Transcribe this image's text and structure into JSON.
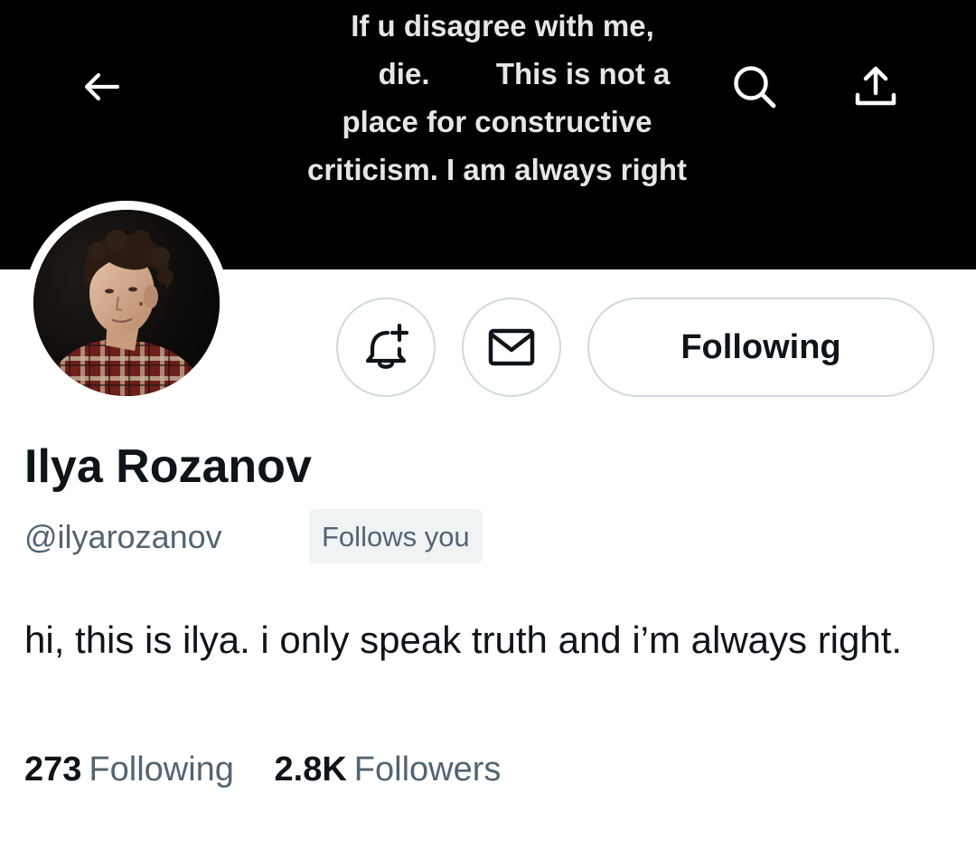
{
  "banner": {
    "text_lines": [
      "If u disagree with me,",
      "die.        This is not a",
      "place for constructive",
      "criticism. I am always right"
    ]
  },
  "header": {
    "back_icon": "arrow-left-icon",
    "search_icon": "search-icon",
    "share_icon": "share-upload-icon"
  },
  "profile": {
    "display_name": "Ilya Rozanov",
    "handle": "@ilyarozanov",
    "follows_you_badge": "Follows you",
    "bio": "hi, this is ilya. i only speak truth and i’m always right.",
    "avatar_icon": "profile-photo"
  },
  "actions": {
    "notify_icon": "bell-plus-icon",
    "message_icon": "envelope-icon",
    "following_label": "Following"
  },
  "stats": {
    "following_count": "273",
    "following_label": "Following",
    "followers_count": "2.8K",
    "followers_label": "Followers"
  },
  "colors": {
    "text_primary": "#0f1419",
    "text_secondary": "#536471",
    "border": "#cfd9de",
    "badge_bg": "#eff3f4",
    "banner_bg": "#000000"
  }
}
